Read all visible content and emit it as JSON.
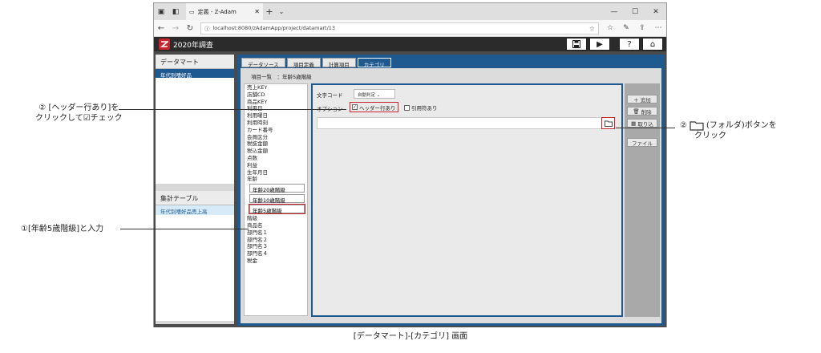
{
  "browser": {
    "tab_title": "定義 - Z-Adam",
    "url": "localhost:8080/zAdamApp/project/datamart/13"
  },
  "app": {
    "title": "2020年調査"
  },
  "left": {
    "datamart_header": "データマート",
    "datamart_selected": "年代別嗜好品",
    "agg_header": "集計テーブル",
    "agg_item": "年代別嗜好品売上高"
  },
  "tabs": [
    "データソース",
    "項目定義",
    "計算項目",
    "カテゴリ"
  ],
  "items_title": "項目一覧　：年齢5歳階級",
  "items": [
    "売上KEY",
    "店舗CD",
    "商品KEY",
    "利用日",
    "利用曜日",
    "利用時刻",
    "カード番号",
    "会員区分",
    "税抜金額",
    "税込金額",
    "点数",
    "利益",
    "生年月日",
    "年齢"
  ],
  "sub_items": [
    "年齢20歳階級",
    "年齢10歳階級",
    "年齢5歳階級"
  ],
  "items_after": [
    "階級",
    "商品名",
    "部門名１",
    "部門名２",
    "部門名３",
    "部門名４",
    "税金"
  ],
  "config": {
    "encoding_label": "文字コード",
    "encoding_value": "自動判定",
    "option_label": "オプション",
    "header_row": "ヘッダー行あり",
    "header_checked": "✓",
    "quote_label": "引用符あり"
  },
  "buttons": {
    "add": "追加",
    "delete": "削除",
    "refresh": "取り込",
    "file": "ファイル"
  },
  "annotations": {
    "a1_line1": "② [ヘッダー行あり]を",
    "a1_line2": "クリックして☑チェック",
    "a2": "①[年齢5歳階級]と入力",
    "a3_prefix": "②",
    "a3_line1": "(フォルダ)ボタンを",
    "a3_line2": "クリック"
  },
  "caption": "[データマート]-[カテゴリ] 画面"
}
